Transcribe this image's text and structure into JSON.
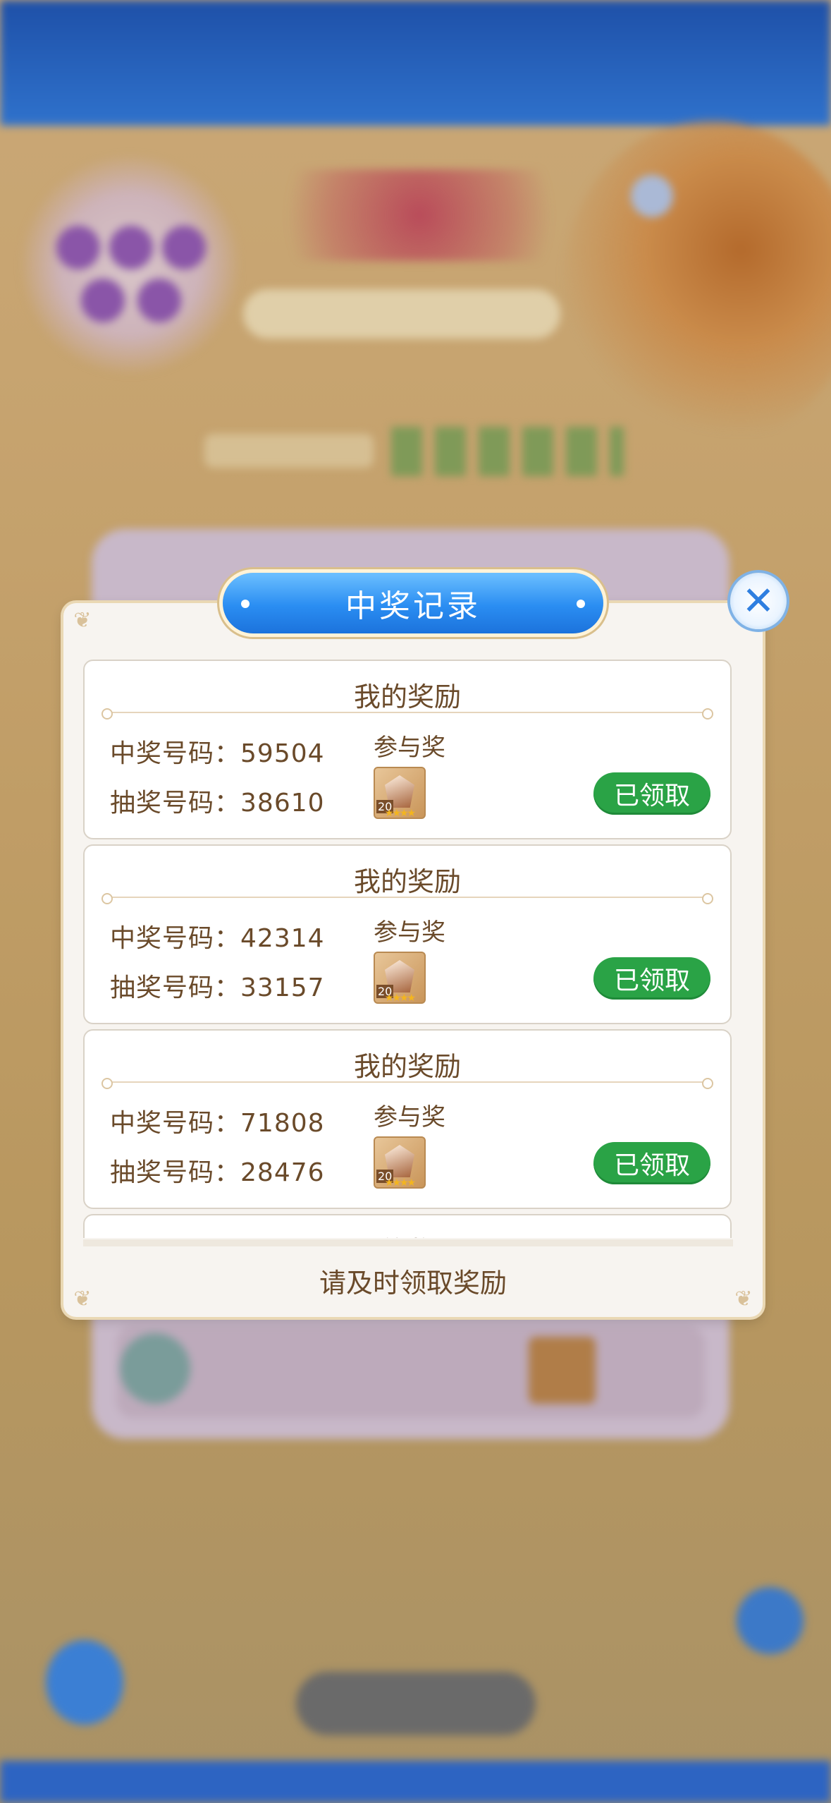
{
  "modal": {
    "title": "中奖记录",
    "close_icon": "close-icon",
    "footer": "请及时领取奖励",
    "records": [
      {
        "section_title": "我的奖励",
        "win_number_label": "中奖号码：",
        "win_number": "59504",
        "draw_number_label": "抽奖号码：",
        "draw_number": "38610",
        "prize_name": "参与奖",
        "prize_level": "20",
        "claim_label": "已领取"
      },
      {
        "section_title": "我的奖励",
        "win_number_label": "中奖号码：",
        "win_number": "42314",
        "draw_number_label": "抽奖号码：",
        "draw_number": "33157",
        "prize_name": "参与奖",
        "prize_level": "20",
        "claim_label": "已领取"
      },
      {
        "section_title": "我的奖励",
        "win_number_label": "中奖号码：",
        "win_number": "71808",
        "draw_number_label": "抽奖号码：",
        "draw_number": "28476",
        "prize_name": "参与奖",
        "prize_level": "20",
        "claim_label": "已领取"
      },
      {
        "section_title": "我的奖励"
      }
    ]
  },
  "colors": {
    "accent_blue": "#2a8df2",
    "claim_green": "#2aa346",
    "text_brown": "#6a4a2a"
  }
}
